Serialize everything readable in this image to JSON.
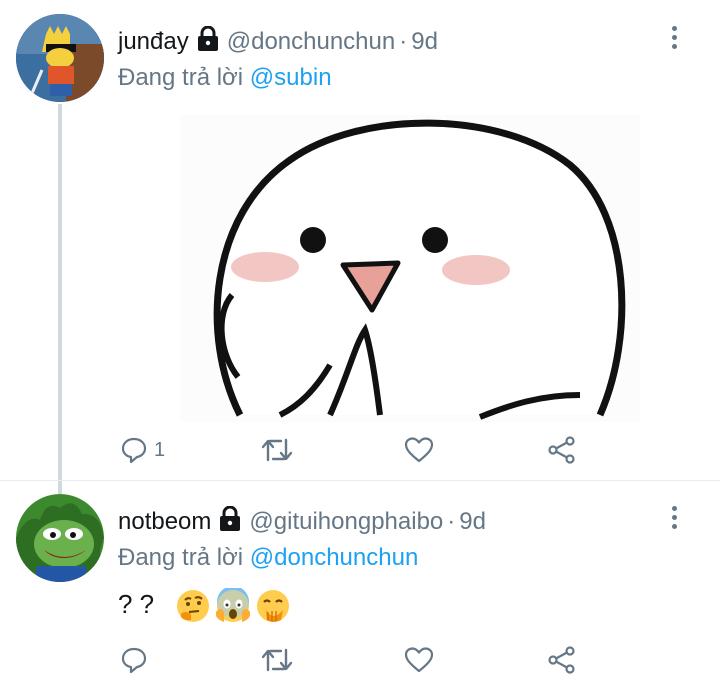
{
  "tweets": [
    {
      "name": "junđay",
      "handle": "@donchunchun",
      "time": "9d",
      "reply_prefix": "Đang trả lời",
      "reply_mention": "@subin",
      "reply_count": "1",
      "retweet_count": "",
      "like_count": ""
    },
    {
      "name": "notbeom",
      "handle": "@gituihongphaibo",
      "time": "9d",
      "reply_prefix": "Đang trả lời",
      "reply_mention": "@donchunchun",
      "text": "? ?",
      "emojis": [
        "thinking-face",
        "face-screaming-in-fear",
        "face-with-hand-over-mouth"
      ],
      "reply_count": "",
      "retweet_count": "",
      "like_count": ""
    }
  ],
  "separator": "·",
  "colors": {
    "link": "#1da1f2",
    "secondary": "#657786",
    "thread_line": "#cfd9de"
  }
}
